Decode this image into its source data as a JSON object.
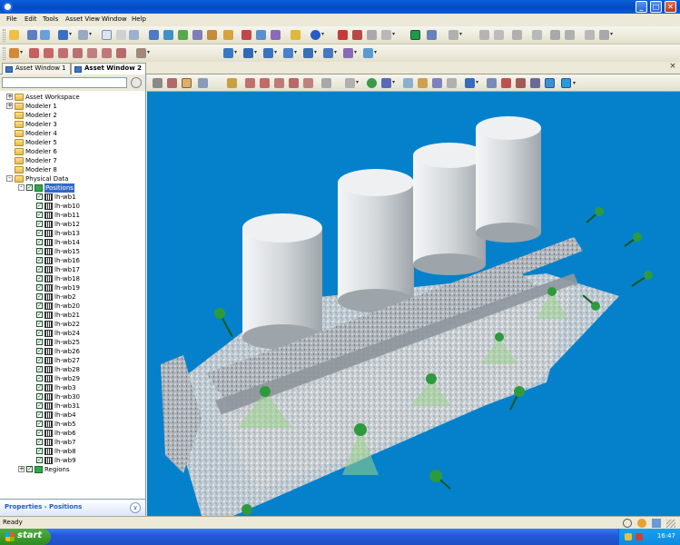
{
  "window": {
    "title": ""
  },
  "menu": [
    "File",
    "Edit",
    "Tools",
    "Asset View",
    "Window",
    "Help"
  ],
  "tabs": [
    {
      "label": "Asset Window 1",
      "active": false
    },
    {
      "label": "Asset Window 2",
      "active": true
    }
  ],
  "search": {
    "value": ""
  },
  "tree": {
    "roots": [
      "Asset Workspace",
      "Modeler 1",
      "Modeler 2",
      "Modeler 3",
      "Modeler 4",
      "Modeler 5",
      "Modeler 6",
      "Modeler 7",
      "Modeler 8"
    ],
    "physical_data": "Physical Data",
    "positions": "Positions",
    "position_items": [
      "lh-wb1",
      "lh-wb10",
      "lh-wb11",
      "lh-wb12",
      "lh-wb13",
      "lh-wb14",
      "lh-wb15",
      "lh-wb16",
      "lh-wb17",
      "lh-wb18",
      "lh-wb19",
      "lh-wb2",
      "lh-wb20",
      "lh-wb21",
      "lh-wb22",
      "lh-wb24",
      "lh-wb25",
      "lh-wb26",
      "lh-wb27",
      "lh-wb28",
      "lh-wb29",
      "lh-wb3",
      "lh-wb30",
      "lh-wb31",
      "lh-wb4",
      "lh-wb5",
      "lh-wb6",
      "lh-wb7",
      "lh-wb8",
      "lh-wb9"
    ],
    "regions": "Regions"
  },
  "properties_bar": {
    "label": "Properties - Positions"
  },
  "viewport": {
    "background": "#0581cb",
    "scan_color": "#d9dde0",
    "marker_color": "#2e9a3e"
  },
  "status": {
    "text": "Ready"
  },
  "taskbar": {
    "start_label": "start",
    "clock": "16:47"
  }
}
